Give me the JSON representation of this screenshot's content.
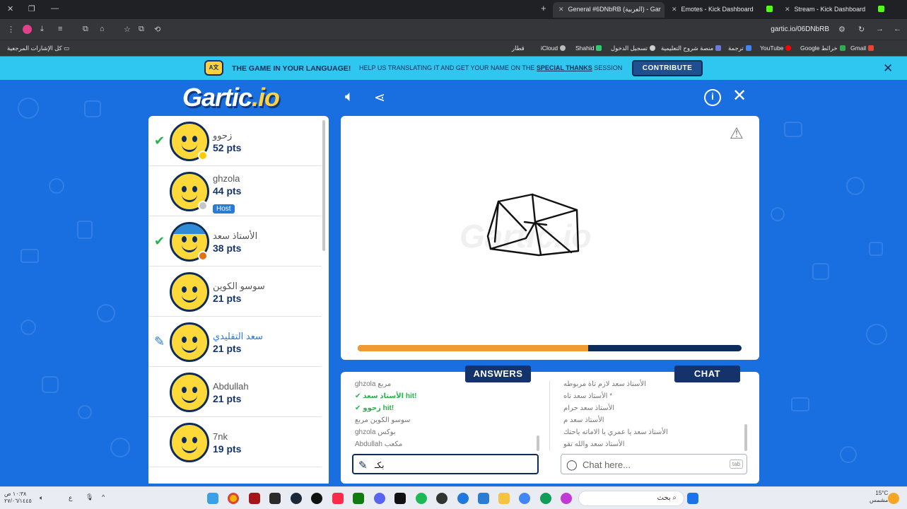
{
  "browser": {
    "tabs": [
      {
        "label": "General #6DNbRB (العربية) - Gar",
        "badge_color": "#1fa3e0",
        "active": true
      },
      {
        "label": "Emotes - Kick Dashboard",
        "badge_color": "#53fc18",
        "active": false
      },
      {
        "label": "Stream - Kick Dashboard",
        "badge_color": "#53fc18",
        "active": false
      }
    ],
    "new_tab": "+",
    "url": "gartic.io/06DNbRB",
    "bookmarks_left": "كل الإشارات المرجعية",
    "bookmarks": [
      "Gmail",
      "Google خرائط",
      "YouTube",
      "ترجمة",
      "منصة شروح التعليمية",
      "تسجيل الدخول",
      "Shahid",
      "iCloud",
      "قطار"
    ]
  },
  "banner": {
    "headline": "THE GAME IN YOUR LANGUAGE!",
    "sub_prefix": "HELP US TRANSLATING IT AND GET YOUR NAME ON THE",
    "sub_link": "SPECIAL THANKS",
    "sub_suffix": "SESSION",
    "contribute": "CONTRIBUTE",
    "icon_text": "A文"
  },
  "logo": {
    "main": "Gartic",
    "suffix": ".io"
  },
  "players": [
    {
      "name": "زحوو",
      "points": "52 pts",
      "mark": "check",
      "status_color": "#ffcc00",
      "host": ""
    },
    {
      "name": "ghzola",
      "points": "44 pts",
      "mark": "",
      "status_color": "#c6c6c6",
      "host": "Host"
    },
    {
      "name": "الأستاذ سعد",
      "points": "38 pts",
      "mark": "check",
      "status_color": "#e0701a",
      "host": ""
    },
    {
      "name": "سوسو الكوين",
      "points": "21 pts",
      "mark": "",
      "status_color": "",
      "host": ""
    },
    {
      "name": "سعد التقليدي",
      "points": "21 pts",
      "mark": "pencil",
      "status_color": "",
      "host": ""
    },
    {
      "name": "Abdullah",
      "points": "21 pts",
      "mark": "",
      "status_color": "",
      "host": ""
    },
    {
      "name": "7nk",
      "points": "19 pts",
      "mark": "",
      "status_color": "",
      "host": ""
    }
  ],
  "timer": {
    "progress": 0.6
  },
  "answers": {
    "title": "ANSWERS",
    "messages": [
      {
        "text": "ghzola مربع",
        "hit": false
      },
      {
        "text": "الأستاذ سعد hit!",
        "hit": true
      },
      {
        "text": "زحوو hit!",
        "hit": true
      },
      {
        "text": "سوسو الكوين مربع",
        "hit": false
      },
      {
        "text": "ghzola بوكس",
        "hit": false
      },
      {
        "text": "Abdullah مكعب",
        "hit": false
      }
    ],
    "input_value": "بكـ"
  },
  "chat": {
    "title": "CHAT",
    "messages": [
      "الأستاذ سعد لازم تاة مربوطه",
      "الأستاذ سعد تاه *",
      "الأستاذ سعد حرام",
      "الأستاذ سعد م",
      "الأستاذ سعد يا عمري يا الاماته ياحتك",
      "الأستاذ سعد والله تقو"
    ],
    "placeholder": "Chat here...",
    "tab_key": "tab"
  },
  "taskbar": {
    "search": "بحث",
    "clock_time": "١٠:٣٨ ص",
    "clock_date": "٢٧/٠٦/١٤٤٥",
    "weather_temp": "15°C",
    "weather_text": "مشمس",
    "lang": "ع"
  }
}
